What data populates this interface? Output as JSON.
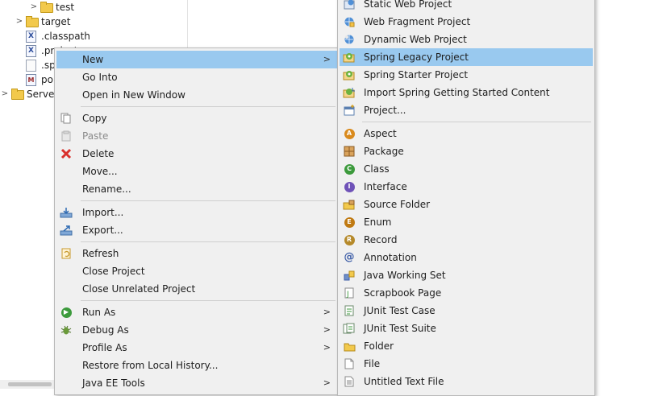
{
  "explorer": {
    "items": [
      {
        "label": "test",
        "arrow": ">",
        "icon": "folder-icon"
      },
      {
        "label": "target",
        "arrow": ">",
        "icon": "folder-icon"
      },
      {
        "label": ".classpath",
        "arrow": "",
        "icon": "xml-file-icon"
      },
      {
        "label": ".project",
        "arrow": "",
        "icon": "xml-file-icon"
      },
      {
        "label": ".sp",
        "arrow": "",
        "icon": "file-icon"
      },
      {
        "label": "po",
        "arrow": "",
        "icon": "maven-file-icon"
      },
      {
        "label": "Serve",
        "arrow": ">",
        "icon": "folder-icon"
      }
    ]
  },
  "context_menu": {
    "items": [
      {
        "label": "New",
        "submenu": true,
        "selected": true
      },
      {
        "label": "Go Into"
      },
      {
        "label": "Open in New Window"
      },
      {
        "label": "Copy",
        "icon": "copy-icon"
      },
      {
        "label": "Paste",
        "icon": "paste-icon",
        "disabled": true
      },
      {
        "label": "Delete",
        "icon": "delete-icon"
      },
      {
        "label": "Move..."
      },
      {
        "label": "Rename..."
      },
      {
        "label": "Import...",
        "icon": "import-icon"
      },
      {
        "label": "Export...",
        "icon": "export-icon"
      },
      {
        "label": "Refresh",
        "icon": "refresh-icon"
      },
      {
        "label": "Close Project"
      },
      {
        "label": "Close Unrelated Project"
      },
      {
        "label": "Run As",
        "icon": "run-icon",
        "submenu": true
      },
      {
        "label": "Debug As",
        "icon": "debug-icon",
        "submenu": true
      },
      {
        "label": "Profile As",
        "submenu": true
      },
      {
        "label": "Restore from Local History..."
      },
      {
        "label": "Java EE Tools",
        "submenu": true
      }
    ]
  },
  "new_submenu": {
    "items": [
      {
        "label": "Static Web Project",
        "icon": "static-web-project-icon"
      },
      {
        "label": "Web Fragment Project",
        "icon": "web-fragment-project-icon"
      },
      {
        "label": "Dynamic Web Project",
        "icon": "dynamic-web-project-icon"
      },
      {
        "label": "Spring Legacy Project",
        "icon": "spring-legacy-project-icon",
        "selected": true
      },
      {
        "label": "Spring Starter Project",
        "icon": "spring-starter-project-icon"
      },
      {
        "label": "Import Spring Getting Started Content",
        "icon": "spring-import-icon"
      },
      {
        "label": "Project...",
        "icon": "project-icon"
      },
      {
        "label": "Aspect",
        "icon": "aspect-icon"
      },
      {
        "label": "Package",
        "icon": "package-icon"
      },
      {
        "label": "Class",
        "icon": "class-icon"
      },
      {
        "label": "Interface",
        "icon": "interface-icon"
      },
      {
        "label": "Source Folder",
        "icon": "source-folder-icon"
      },
      {
        "label": "Enum",
        "icon": "enum-icon"
      },
      {
        "label": "Record",
        "icon": "record-icon"
      },
      {
        "label": "Annotation",
        "icon": "annotation-icon"
      },
      {
        "label": "Java Working Set",
        "icon": "working-set-icon"
      },
      {
        "label": "Scrapbook Page",
        "icon": "scrapbook-icon"
      },
      {
        "label": "JUnit Test Case",
        "icon": "junit-test-case-icon"
      },
      {
        "label": "JUnit Test Suite",
        "icon": "junit-test-suite-icon"
      },
      {
        "label": "Folder",
        "icon": "folder-icon"
      },
      {
        "label": "File",
        "icon": "file-icon"
      },
      {
        "label": "Untitled Text File",
        "icon": "text-file-icon"
      }
    ]
  },
  "colors": {
    "selection": "#99c9ef",
    "menu_bg": "#f0f0f0",
    "spring_green": "#6db33f",
    "java_class_green": "#3c9a3c",
    "interface_purple": "#6f52b8",
    "enum_orange": "#c07a12"
  }
}
